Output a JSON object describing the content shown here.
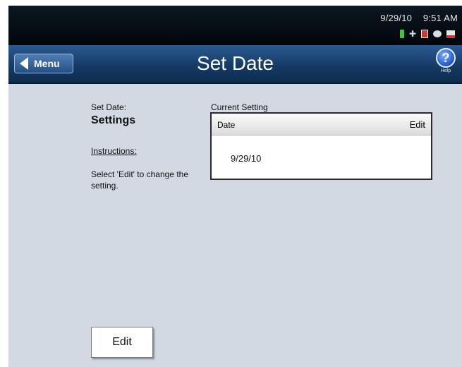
{
  "status": {
    "date": "9/29/10",
    "time": "9:51 AM",
    "icons": [
      "battery-icon",
      "plug-icon",
      "document-icon",
      "signal-icon",
      "printer-icon"
    ]
  },
  "titlebar": {
    "menu_label": "Menu",
    "title": "Set Date",
    "help_label": "Help"
  },
  "left_panel": {
    "caption": "Set Date:",
    "heading": "Settings",
    "instructions_label": "Instructions:",
    "instructions_text": "Select 'Edit' to change the setting."
  },
  "current_setting": {
    "caption": "Current Setting",
    "column_label": "Date",
    "edit_label": "Edit",
    "value": "9/29/10"
  },
  "footer": {
    "edit_button": "Edit"
  },
  "colors": {
    "titlebar_blue": "#163b66",
    "content_bg": "#d2d9e3",
    "statusbar_bg": "#0c1722"
  }
}
